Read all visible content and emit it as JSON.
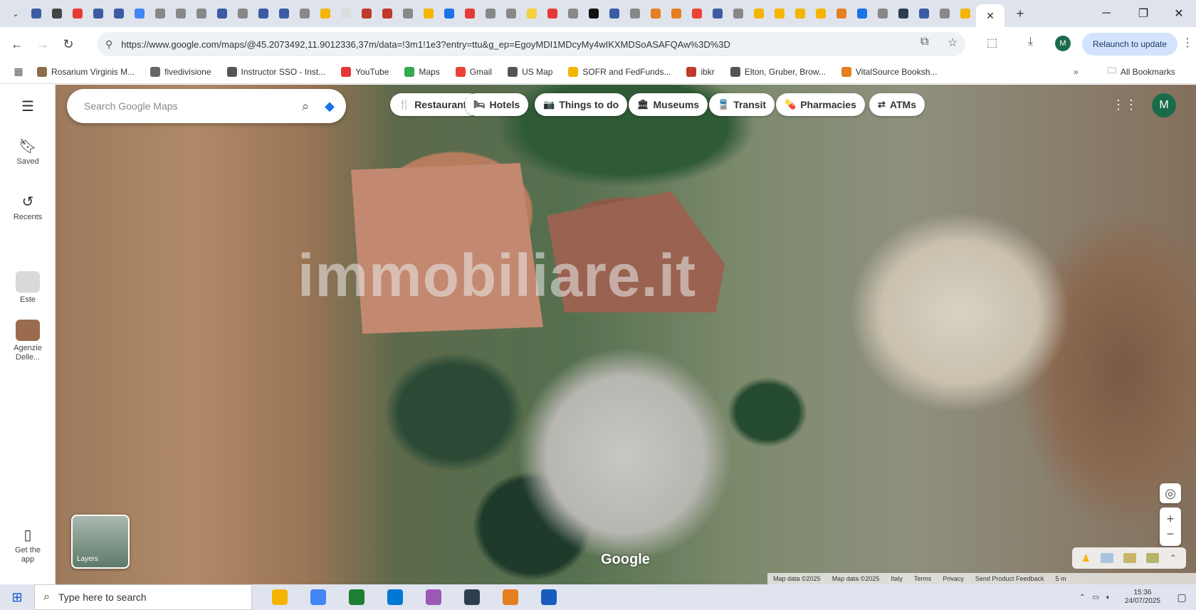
{
  "browser": {
    "tab_colors": [
      "#3b5ba5",
      "#444",
      "#e53935",
      "#3b5ba5",
      "#3b5ba5",
      "#4285f4",
      "#888",
      "#888",
      "#888",
      "#3b5ba5",
      "#888",
      "#3b5ba5",
      "#3b5ba5",
      "#888",
      "#f4b400",
      "#ddd",
      "#c0392b",
      "#c0392b",
      "#888",
      "#f4b400",
      "#1a73e8",
      "#e53935",
      "#888",
      "#888",
      "#f4d03f",
      "#e53935",
      "#888",
      "#111",
      "#3b5ba5",
      "#888",
      "#e67e22",
      "#e67e22",
      "#ea4335",
      "#3b5ba5",
      "#888",
      "#f4b400",
      "#f4b400",
      "#f4b400",
      "#f4b400",
      "#e67e22",
      "#1a73e8",
      "#888",
      "#2c3e50",
      "#3b5ba5",
      "#888",
      "#f4b400"
    ],
    "active_tab_close": "✕",
    "new_tab": "+",
    "url": "https://www.google.com/maps/@45.2073492,11.9012336,37m/data=!3m1!1e3?entry=ttu&g_ep=EgoyMDI1MDcyMy4wIKXMDSoASAFQAw%3D%3D",
    "relaunch_label": "Relaunch to update",
    "profile_initial": "M",
    "window_min": "─",
    "window_max": "❐",
    "window_close": "✕"
  },
  "bookmarks": [
    {
      "label": "Rosarium Virginis M...",
      "color": "#8e6b4b"
    },
    {
      "label": "fivedivisione",
      "color": "#666"
    },
    {
      "label": "Instructor SSO - Inst...",
      "color": "#555"
    },
    {
      "label": "YouTube",
      "color": "#e53935"
    },
    {
      "label": "Maps",
      "color": "#34a853"
    },
    {
      "label": "Gmail",
      "color": "#ea4335"
    },
    {
      "label": "US Map",
      "color": "#555"
    },
    {
      "label": "SOFR and FedFunds...",
      "color": "#f4b400"
    },
    {
      "label": "ibkr",
      "color": "#c0392b"
    },
    {
      "label": "Elton, Gruber, Brow...",
      "color": "#555"
    },
    {
      "label": "VitalSource Booksh...",
      "color": "#e67e22"
    }
  ],
  "all_bookmarks_label": "All Bookmarks",
  "rail": {
    "saved": "Saved",
    "recents": "Recents",
    "item3": "Este",
    "item4": "Agenzie Delle...",
    "get_app": "Get the app"
  },
  "search": {
    "placeholder": "Search Google Maps"
  },
  "chips": [
    {
      "label": "Restaurants",
      "icon": "🍴"
    },
    {
      "label": "Hotels",
      "icon": "🛏"
    },
    {
      "label": "Things to do",
      "icon": "📷"
    },
    {
      "label": "Museums",
      "icon": "🏛"
    },
    {
      "label": "Transit",
      "icon": "🚆"
    },
    {
      "label": "Pharmacies",
      "icon": "💊"
    },
    {
      "label": "ATMs",
      "icon": "⇄"
    }
  ],
  "map": {
    "watermark": "immobiliare.it",
    "google_logo": "Google",
    "layers_label": "Layers",
    "attribution": [
      "Map data ©2025",
      "Map data ©2025",
      "Italy",
      "Terms",
      "Privacy",
      "Send Product Feedback",
      "5 m"
    ]
  },
  "taskbar": {
    "search_placeholder": "Type here to search",
    "time": "15:36",
    "date": "24/07/2025",
    "apps": [
      "#f4b400",
      "#4285f4",
      "#1e7e34",
      "#0078d4",
      "#9b59b6",
      "#2c3e50",
      "#e67e22",
      "#185abd"
    ]
  }
}
